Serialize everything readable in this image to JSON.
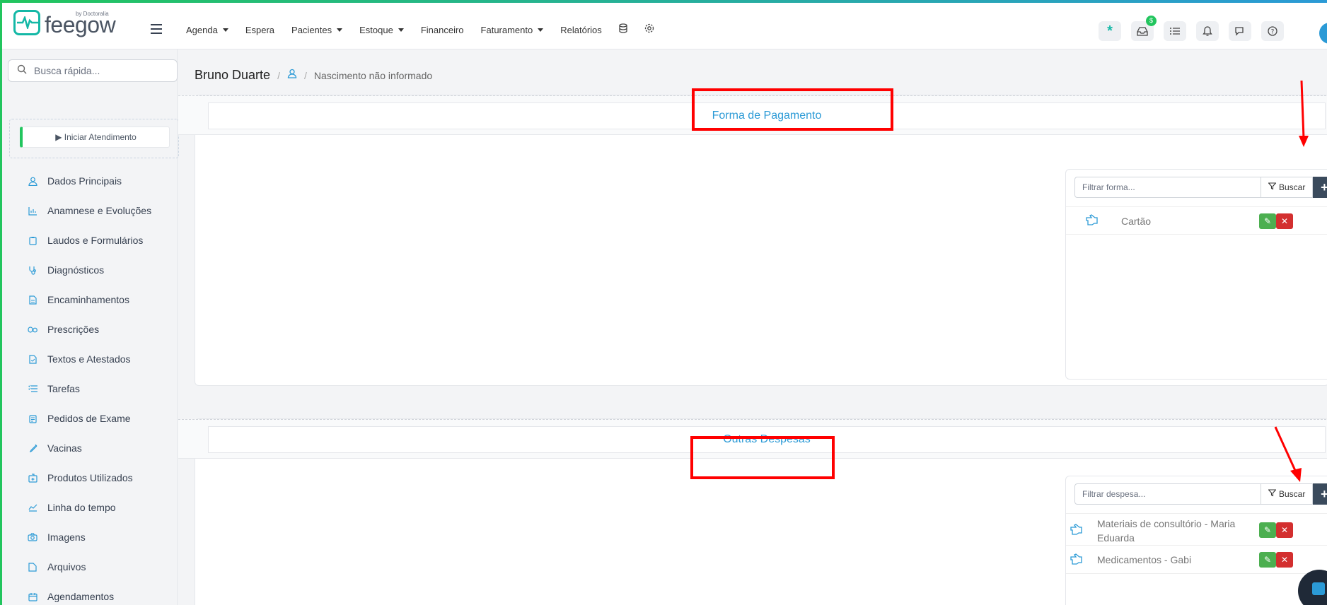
{
  "header": {
    "logo_text": "feegow",
    "logo_by": "by Doctoralia",
    "nav": [
      {
        "label": "Agenda",
        "dropdown": true
      },
      {
        "label": "Espera",
        "dropdown": false
      },
      {
        "label": "Pacientes",
        "dropdown": true
      },
      {
        "label": "Estoque",
        "dropdown": true
      },
      {
        "label": "Financeiro",
        "dropdown": false
      },
      {
        "label": "Faturamento",
        "dropdown": true
      },
      {
        "label": "Relatórios",
        "dropdown": false
      }
    ],
    "badge": "$"
  },
  "sidebar": {
    "search_placeholder": "Busca rápida...",
    "start_button": "▶ Iniciar Atendimento",
    "items": [
      {
        "label": "Dados Principais",
        "icon": "user-icon"
      },
      {
        "label": "Anamnese e Evoluções",
        "icon": "chart-icon"
      },
      {
        "label": "Laudos e Formulários",
        "icon": "clipboard-icon"
      },
      {
        "label": "Diagnósticos",
        "icon": "stethoscope-icon"
      },
      {
        "label": "Encaminhamentos",
        "icon": "document-icon"
      },
      {
        "label": "Prescrições",
        "icon": "pills-icon"
      },
      {
        "label": "Textos e Atestados",
        "icon": "file-text-icon"
      },
      {
        "label": "Tarefas",
        "icon": "tasks-icon"
      },
      {
        "label": "Pedidos de Exame",
        "icon": "exam-icon"
      },
      {
        "label": "Vacinas",
        "icon": "syringe-icon"
      },
      {
        "label": "Produtos Utilizados",
        "icon": "box-icon"
      },
      {
        "label": "Linha do tempo",
        "icon": "timeline-icon"
      },
      {
        "label": "Imagens",
        "icon": "camera-icon"
      },
      {
        "label": "Arquivos",
        "icon": "file-icon"
      },
      {
        "label": "Agendamentos",
        "icon": "calendar-icon"
      }
    ]
  },
  "main": {
    "patient_name": "Bruno Duarte",
    "birth_info": "Nascimento não informado",
    "sections": [
      {
        "title": "Forma de Pagamento",
        "filter_placeholder": "Filtrar forma...",
        "buscar_label": "Buscar",
        "plus_label": "+",
        "rows": [
          "Cartão"
        ]
      },
      {
        "title": "Outras Despesas",
        "filter_placeholder": "Filtrar despesa...",
        "buscar_label": "Buscar",
        "plus_label": "+",
        "rows": [
          "Materiais de consultório - Maria Eduarda",
          "Medicamentos - Gabi"
        ]
      }
    ]
  },
  "colors": {
    "accent": "#2b9ad6",
    "brand": "#14b8a6",
    "annotation": "#ff0000",
    "edit": "#4caf50",
    "delete": "#d32f2f"
  }
}
